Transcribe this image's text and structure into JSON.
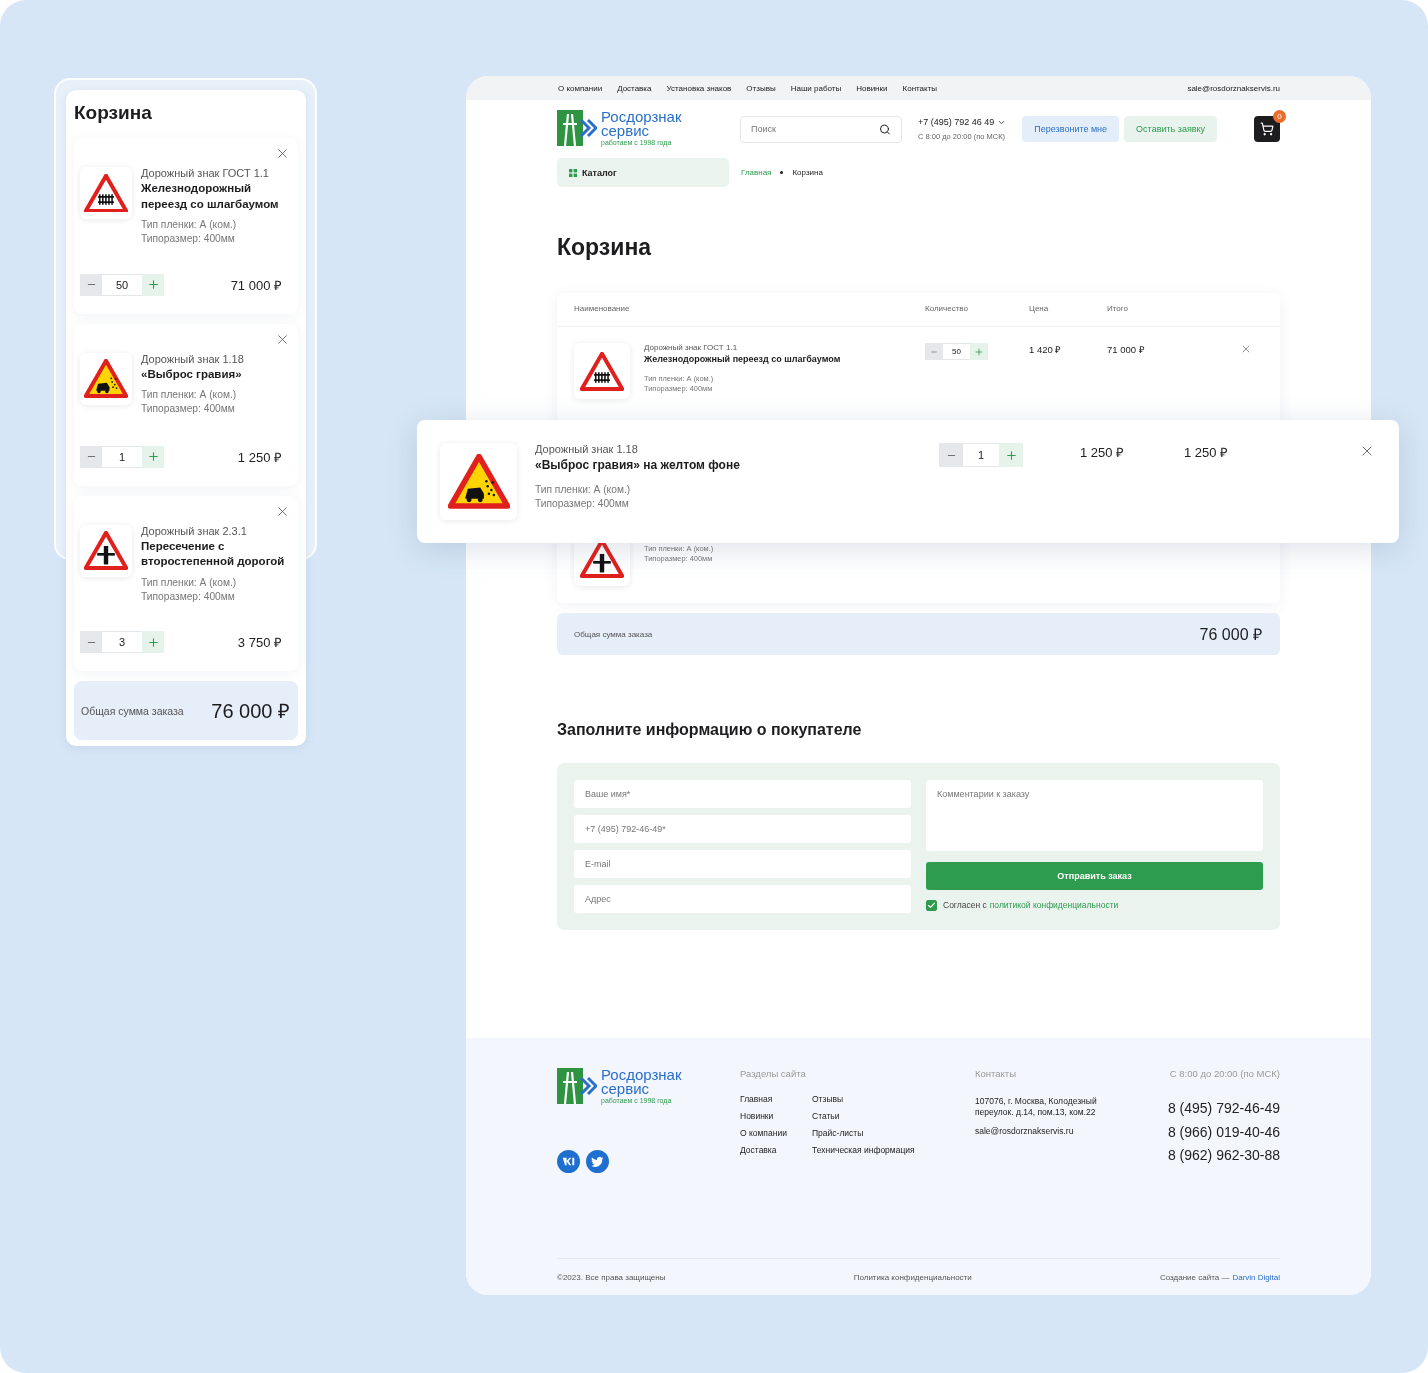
{
  "mobile": {
    "title": "Корзина",
    "items": [
      {
        "category": "Дорожный знак ГОСТ 1.1",
        "name": "Железнодорожный переезд со шлагбаумом",
        "film": "Тип пленки: А (ком.)",
        "size": "Типоразмер: 400мм",
        "qty": "50",
        "total": "71 000 ₽"
      },
      {
        "category": "Дорожный знак 1.18",
        "name": "«Выброс гравия»",
        "film": "Тип пленки: А (ком.)",
        "size": "Типоразмер: 400мм",
        "qty": "1",
        "total": "1 250 ₽"
      },
      {
        "category": "Дорожный знак 2.3.1",
        "name": "Пересечение с второстепенной дорогой",
        "film": "Тип пленки: А (ком.)",
        "size": "Типоразмер: 400мм",
        "qty": "3",
        "total": "3 750 ₽"
      }
    ],
    "total_label": "Общая сумма заказа",
    "total": "76 000 ₽"
  },
  "desktop": {
    "top_nav": [
      "О компании",
      "Доставка",
      "Установка знаков",
      "Отзывы",
      "Наши работы",
      "Новинки",
      "Контакты"
    ],
    "email": "sale@rosdorznakservis.ru",
    "logo": {
      "line_1": "Росдорзнак",
      "line_2": "сервис",
      "tagline": "работаем с 1998 года"
    },
    "search": {
      "placeholder": "Поиск"
    },
    "phone": "+7 (495) 792 46 49",
    "hours": "С 8:00 до 20:00 (по МСК)",
    "callback_button": "Перезвоните мне",
    "request_button": "Оставить заявку",
    "cart_count": "0",
    "catalog_button": "Каталог",
    "breadcrumbs": [
      {
        "label": "Главная",
        "current": false
      },
      {
        "label": "Корзина",
        "current": true
      }
    ],
    "heading": "Корзина",
    "table": {
      "columns": [
        "Наименование",
        "Количество",
        "Цена",
        "Итого"
      ],
      "rows": [
        {
          "kind": "full",
          "category": "Дорожный знак ГОСТ 1.1",
          "name": "Железнодорожный переезд со шлагбаумом",
          "film": "Тип пленки: А (ком.)",
          "size": "Типоразмер: 400мм",
          "qty": "50",
          "price": "1 420 ₽",
          "total": "71 000 ₽"
        },
        {
          "kind": "partial",
          "film": "Тип пленки: А (ком.)",
          "size": "Типоразмер: 400мм"
        }
      ]
    },
    "total_label": "Общая сумма заказа",
    "total": "76 000 ₽",
    "form": {
      "heading": "Заполните информацию о покупателе",
      "fields": [
        {
          "placeholder": "Ваше имя*"
        },
        {
          "placeholder": "+7 (495) 792-46-49*"
        },
        {
          "placeholder": "E-mail"
        },
        {
          "placeholder": "Адрес"
        }
      ],
      "comment": {
        "placeholder": "Комментарии к заказу"
      },
      "submit": "Отправить заказ",
      "consent": {
        "checked": true,
        "text": "Согласен с",
        "link": "политикой конфиденциальности"
      }
    },
    "footer": {
      "logo": {
        "line_1": "Росдорзнак",
        "line_2": "сервис",
        "tagline": "работаем с 1998 года"
      },
      "sections_heading": "Разделы сайта",
      "links": [
        [
          "Главная",
          "Новинки",
          "О компании",
          "Доставка"
        ],
        [
          "Отзывы",
          "Статьи",
          "Прайс-листы",
          "Техническая информация"
        ]
      ],
      "contacts_heading": "Контакты",
      "address": "107076, г. Москва, Колодезный переулок. д.14, пом.13, ком.22",
      "email": "sale@rosdorznakservis.ru",
      "hours": "С 8:00 до 20:00 (по МСК)",
      "phones": [
        "8 (495) 792-46-49",
        "8 (966) 019-40-46",
        "8 (962) 962-30-88"
      ],
      "copyright": "©2023. Все права защищены",
      "policy": "Политика конфиденциальности",
      "credit": "Создание сайта —",
      "credit_link": "Darvin Digital"
    }
  },
  "floating_item": {
    "category": "Дорожный знак 1.18",
    "name": "«Выброс гравия» на желтом фоне",
    "film": "Тип пленки: А (ком.)",
    "size": "Типоразмер: 400мм",
    "qty": "1",
    "price": "1 250 ₽",
    "total": "1 250 ₽"
  }
}
